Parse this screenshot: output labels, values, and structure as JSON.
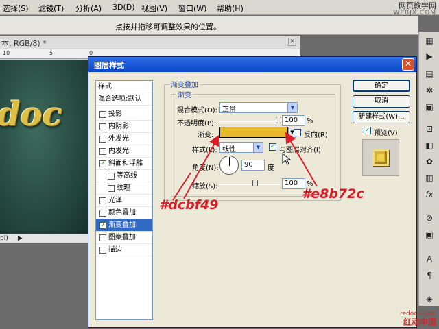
{
  "menubar": {
    "items": [
      "选择(S)",
      "滤镜(T)",
      "分析(A)",
      "3D(D)",
      "视图(V)",
      "窗口(W)",
      "帮助(H)"
    ],
    "watermark_line1": "网页教学网",
    "watermark_line2": "WEBJX.COM"
  },
  "options_bar": {
    "hint": "点按并拖移可调整效果的位置。"
  },
  "document": {
    "title": "本, RGB/8) *",
    "ruler_ticks": [
      "10",
      "5",
      "0"
    ],
    "canvas_text": "doc",
    "status_zoom": "pi)",
    "status_arrow": "▶"
  },
  "dialog": {
    "title": "图层样式",
    "style_list": [
      {
        "label": "样式",
        "checkbox": false,
        "checked": false,
        "selected": false
      },
      {
        "label": "混合选项:默认",
        "checkbox": false,
        "checked": false,
        "selected": false
      },
      {
        "label": "投影",
        "checkbox": true,
        "checked": false,
        "selected": false
      },
      {
        "label": "内阴影",
        "checkbox": true,
        "checked": false,
        "selected": false
      },
      {
        "label": "外发光",
        "checkbox": true,
        "checked": false,
        "selected": false
      },
      {
        "label": "内发光",
        "checkbox": true,
        "checked": false,
        "selected": false
      },
      {
        "label": "斜面和浮雕",
        "checkbox": true,
        "checked": true,
        "selected": false
      },
      {
        "label": "等高线",
        "checkbox": true,
        "checked": false,
        "selected": false
      },
      {
        "label": "纹理",
        "checkbox": true,
        "checked": false,
        "selected": false
      },
      {
        "label": "光泽",
        "checkbox": true,
        "checked": false,
        "selected": false
      },
      {
        "label": "颜色叠加",
        "checkbox": true,
        "checked": false,
        "selected": false
      },
      {
        "label": "渐变叠加",
        "checkbox": true,
        "checked": true,
        "selected": true
      },
      {
        "label": "图案叠加",
        "checkbox": true,
        "checked": false,
        "selected": false
      },
      {
        "label": "描边",
        "checkbox": true,
        "checked": false,
        "selected": false
      }
    ],
    "group_title": "渐变叠加",
    "subgroup_title": "渐变",
    "blend_mode_label": "混合模式(O):",
    "blend_mode_value": "正常",
    "opacity_label": "不透明度(P):",
    "opacity_value": "100",
    "opacity_unit": "%",
    "gradient_label": "渐变:",
    "reverse_label": "反向(R)",
    "style_label": "样式(L):",
    "style_value": "线性",
    "align_label": "与图层对齐(I)",
    "angle_label": "角度(N):",
    "angle_value": "90",
    "angle_unit": "度",
    "scale_label": "缩放(S):",
    "scale_value": "100",
    "scale_unit": "%",
    "buttons": {
      "ok": "确定",
      "cancel": "取消",
      "new_style": "新建样式(W)...",
      "preview": "预览(V)"
    },
    "gradient_color": "#e8b72c"
  },
  "annotations": {
    "left_color": "#dcbf49",
    "right_color": "#e8b72c"
  },
  "footer": {
    "watermark_line1": "redocn.com",
    "watermark_line2": "红动中国"
  }
}
